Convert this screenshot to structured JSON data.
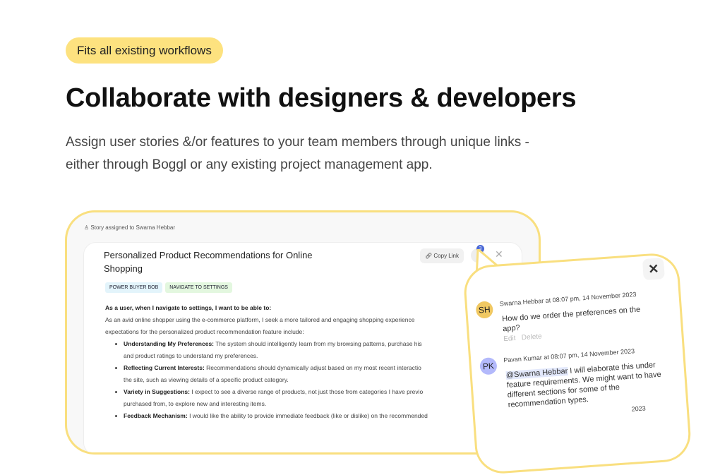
{
  "hero": {
    "badge": "Fits all existing workflows",
    "title": "Collaborate with designers & developers",
    "subtitle": "Assign user stories &/or features to your team members through unique links - either through Boggl or any existing project management app."
  },
  "story": {
    "assigned": "Story assigned to Swarna Hebbar",
    "title": "Personalized Product Recommendations for Online Shopping",
    "copy_link": "Copy Link",
    "comment_count": "3",
    "close": "✕",
    "tags": [
      "POWER BUYER BOB",
      "NAVIGATE TO SETTINGS"
    ],
    "heading": "As a user, when I navigate to settings, I want to be able to:",
    "intro1": "As an avid online shopper using the e-commerce platform, I seek a more tailored and engaging shopping experience",
    "intro2": "expectations for the personalized product recommendation feature include:",
    "items": [
      {
        "label": "Understanding My Preferences:",
        "text": " The system should intelligently learn from my browsing patterns, purchase his",
        "cont": "and product ratings to understand my preferences."
      },
      {
        "label": "Reflecting Current Interests:",
        "text": " Recommendations should dynamically adjust based on my most recent interactio",
        "cont": "the site, such as viewing details of a specific product category."
      },
      {
        "label": "Variety in Suggestions:",
        "text": " I expect to see a diverse range of products, not just those from categories I have previo",
        "cont": "purchased from, to explore new and interesting items."
      },
      {
        "label": "Feedback Mechanism:",
        "text": " I would like the ability to provide immediate feedback (like or dislike) on the recommended",
        "cont": ""
      }
    ]
  },
  "comments": {
    "close": "✕",
    "list": [
      {
        "initials": "SH",
        "color": "#f0c862",
        "meta": "Swarna Hebbar at 08:07 pm, 14 November 2023",
        "text": "How do we order the preferences on the app?",
        "edit": "Edit",
        "delete": "Delete"
      },
      {
        "initials": "PK",
        "color": "#b3b9fb",
        "meta": "Pavan Kumar at 08:07 pm, 14 November 2023",
        "mention": "@Swarna Hebbar",
        "text": " I will elaborate this under feature requirements. We might want to have different sections for some of the recommendation types."
      },
      {
        "meta": "2023"
      }
    ]
  }
}
